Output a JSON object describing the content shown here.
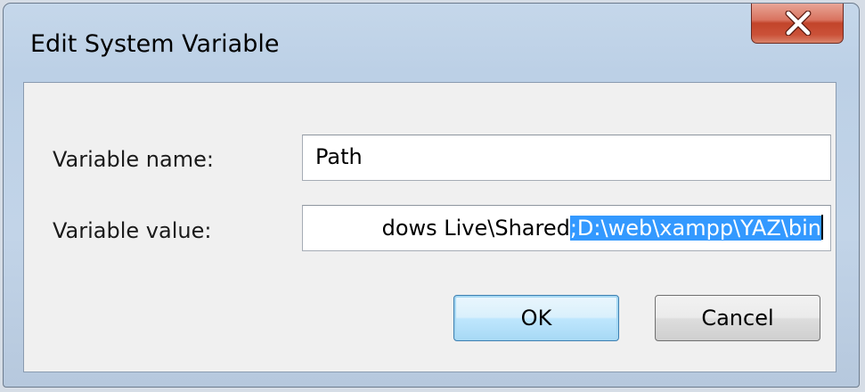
{
  "window": {
    "title": "Edit System Variable"
  },
  "form": {
    "name_label": "Variable name:",
    "name_value": "Path",
    "value_label": "Variable value:",
    "value_unselected": "dows Live\\Shared",
    "value_selected": ";D:\\web\\xampp\\YAZ\\bin"
  },
  "buttons": {
    "ok": "OK",
    "cancel": "Cancel"
  },
  "icons": {
    "close": "close-icon"
  },
  "colors": {
    "selection": "#3399ff",
    "close_button": "#c2442a",
    "default_button_border": "#3c7fb1"
  }
}
